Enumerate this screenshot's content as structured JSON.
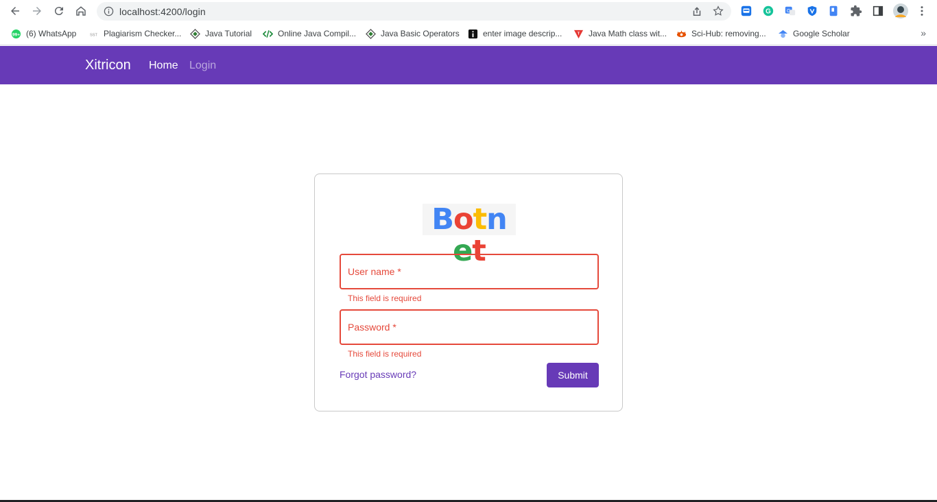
{
  "browser": {
    "url": "localhost:4200/login",
    "icons": [
      "back-icon",
      "forward-icon",
      "reload-icon",
      "home-icon",
      "info-icon",
      "share-icon",
      "star-icon",
      "extensions-icon",
      "side-panel-icon",
      "profile-avatar",
      "menu-icon"
    ]
  },
  "bookmarks": [
    {
      "label": "(6) WhatsApp",
      "icon": "whatsapp-icon"
    },
    {
      "label": "Plagiarism Checker...",
      "icon": "sst-icon"
    },
    {
      "label": "Java Tutorial",
      "icon": "diamond-icon"
    },
    {
      "label": "Online Java Compil...",
      "icon": "code-icon"
    },
    {
      "label": "Java Basic Operators",
      "icon": "diamond-icon"
    },
    {
      "label": "enter image descrip...",
      "icon": "info-black-icon"
    },
    {
      "label": "Java Math class wit...",
      "icon": "triangle-icon"
    },
    {
      "label": "Sci-Hub: removing...",
      "icon": "scihub-icon"
    },
    {
      "label": "Google Scholar",
      "icon": "scholar-icon"
    }
  ],
  "bookmarks_more": "»",
  "navbar": {
    "brand": "Xitricon",
    "links": [
      "Home",
      "Login"
    ]
  },
  "login": {
    "logo_letters": [
      {
        "char": "B",
        "color": "#4285f4"
      },
      {
        "char": "o",
        "color": "#ea4335"
      },
      {
        "char": "t",
        "color": "#fbbc05"
      },
      {
        "char": "n",
        "color": "#4285f4"
      },
      {
        "char": "e",
        "color": "#34a853"
      },
      {
        "char": "t",
        "color": "#ea4335"
      }
    ],
    "username_label": "User name *",
    "password_label": "Password *",
    "username_error": "This field is required",
    "password_error": "This field is required",
    "forgot_label": "Forgot password?",
    "submit_label": "Submit"
  },
  "colors": {
    "primary": "#673ab7",
    "error": "#e5483a"
  }
}
